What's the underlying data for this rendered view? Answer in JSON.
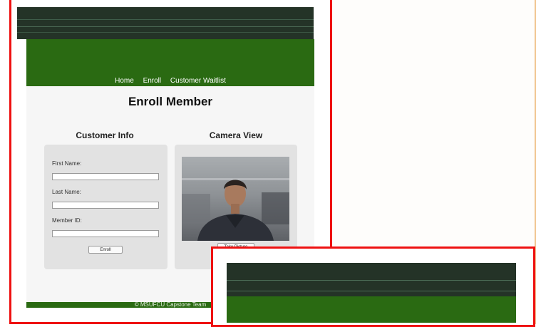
{
  "nav": {
    "items": [
      "Home",
      "Enroll",
      "Customer Waitlist"
    ]
  },
  "page": {
    "title": "Enroll Member"
  },
  "customer_info": {
    "heading": "Customer Info",
    "first_name_label": "First Name:",
    "first_name_value": "",
    "last_name_label": "Last Name:",
    "last_name_value": "",
    "member_id_label": "Member ID:",
    "member_id_value": "",
    "enroll_button": "Enroll"
  },
  "camera": {
    "heading": "Camera View",
    "take_picture_button": "Take Picture"
  },
  "footer": {
    "text": "© MSUFCU Capstone Team"
  },
  "colors": {
    "header_green": "#2a6a12",
    "browser_dark": "#243327",
    "highlight_red": "#ee1111",
    "card_gray": "#e2e2e2"
  }
}
